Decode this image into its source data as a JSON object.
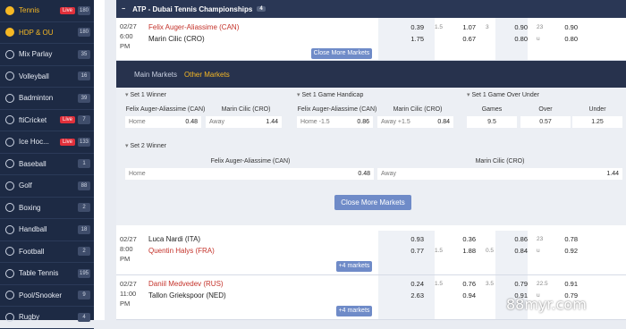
{
  "sidebar": {
    "items": [
      {
        "label": "Tennis",
        "live": "Live",
        "count": "180",
        "active": true
      },
      {
        "label": "HDP & OU",
        "count": "180",
        "active": true
      },
      {
        "label": "Mix Parlay",
        "count": "35"
      },
      {
        "label": "Volleyball",
        "count": "16"
      },
      {
        "label": "Badminton",
        "count": "39"
      },
      {
        "label": "ftiCricket",
        "live": "Live",
        "count": "7"
      },
      {
        "label": "Ice Hoc...",
        "live": "Live",
        "count": "133"
      },
      {
        "label": "Baseball",
        "count": "1"
      },
      {
        "label": "Golf",
        "count": "88"
      },
      {
        "label": "Boxing",
        "count": "2"
      },
      {
        "label": "Handball",
        "count": "18"
      },
      {
        "label": "Football",
        "count": "2"
      },
      {
        "label": "Table Tennis",
        "count": "195"
      },
      {
        "label": "Pool/Snooker",
        "count": "9"
      },
      {
        "label": "Rugby",
        "count": "4"
      }
    ]
  },
  "league": {
    "toggle": "−",
    "name": "ATP - Dubai Tennis Championships",
    "count": "4"
  },
  "match1": {
    "date": "02/27",
    "time": "6:00",
    "ampm": "PM",
    "team1": "Felix Auger-Aliassime (CAN)",
    "team2": "Marin Cilic (CRO)",
    "o1a": "0.39",
    "o1b": "1.75",
    "h1": "1.5",
    "o2a": "1.07",
    "o2b": "0.67",
    "h2": "3",
    "o3a": "0.90",
    "o3b": "0.80",
    "h3": "23",
    "h3b": "u",
    "o4a": "0.90",
    "o4b": "0.80",
    "close_btn": "Close More Markets"
  },
  "markets": {
    "tabs": [
      "Main Markets",
      "Other Markets"
    ],
    "set1_winner": {
      "title": "Set 1 Winner",
      "p1": "Felix Auger-Aliassime (CAN)",
      "p2": "Marin Cilic (CRO)",
      "home": "Home",
      "home_odd": "0.48",
      "away": "Away",
      "away_odd": "1.44"
    },
    "set1_hcap": {
      "title": "Set 1 Game Handicap",
      "p1": "Felix Auger-Aliassime (CAN)",
      "p2": "Marin Cilic (CRO)",
      "home": "Home -1.5",
      "home_odd": "0.86",
      "away": "Away +1.5",
      "away_odd": "0.84"
    },
    "set1_ou": {
      "title": "Set 1 Game Over Under",
      "c1": "Games",
      "c2": "Over",
      "c3": "Under",
      "v1": "9.5",
      "v2": "0.57",
      "v3": "1.25"
    },
    "set2_winner": {
      "title": "Set 2 Winner",
      "p1": "Felix Auger-Aliassime (CAN)",
      "p2": "Marin Cilic (CRO)",
      "home": "Home",
      "home_odd": "0.48",
      "away": "Away",
      "away_odd": "1.44"
    },
    "close_btn": "Close More Markets"
  },
  "match2": {
    "date": "02/27",
    "time": "8:00",
    "ampm": "PM",
    "team1": "Luca Nardi (ITA)",
    "team2": "Quentin Halys (FRA)",
    "o1a": "0.93",
    "o1b": "0.77",
    "h1": "1.5",
    "o2a": "0.36",
    "o2b": "1.88",
    "h2": "0.5",
    "o3a": "0.86",
    "o3b": "0.84",
    "h3": "23",
    "h3b": "u",
    "o4a": "0.78",
    "o4b": "0.92",
    "more_btn": "+4 markets"
  },
  "match3": {
    "date": "02/27",
    "time": "11:00",
    "ampm": "PM",
    "team1": "Daniil Medvedev (RUS)",
    "team2": "Tallon Griekspoor (NED)",
    "o1a": "0.24",
    "o1b": "2.63",
    "h1": "1.5",
    "o2a": "0.76",
    "o2b": "0.94",
    "h2": "3.5",
    "o3a": "0.79",
    "o3b": "0.91",
    "h3": "22.5",
    "h3b": "u",
    "o4a": "0.91",
    "o4b": "0.79",
    "more_btn": "+4 markets"
  },
  "watermark": "88myr.com"
}
